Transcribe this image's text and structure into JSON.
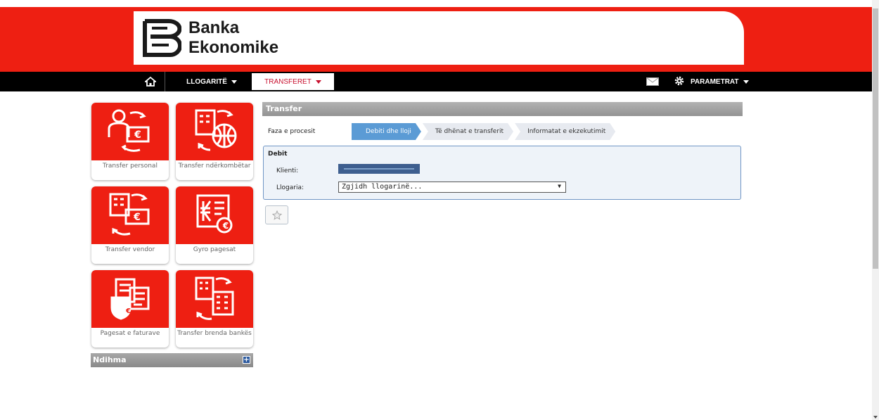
{
  "brand": {
    "line1": "Banka",
    "line2": "Ekonomike",
    "accent_color": "#ee1f12"
  },
  "nav": {
    "home_icon": "home-icon",
    "items": [
      {
        "label": "LLOGARITË"
      },
      {
        "label": "TRANSFERET"
      }
    ],
    "mail_icon": "mail-icon",
    "settings_icon": "gear-icon",
    "settings_label": "PARAMETRAT"
  },
  "tiles": [
    {
      "label": "Transfer personal",
      "icon": "personal-transfer-icon"
    },
    {
      "label": "Transfer ndërkombëtar",
      "icon": "international-transfer-icon"
    },
    {
      "label": "Transfer vendor",
      "icon": "domestic-transfer-icon"
    },
    {
      "label": "Gyro pagesat",
      "icon": "giro-payment-icon"
    },
    {
      "label": "Pagesat e faturave",
      "icon": "bill-payment-icon"
    },
    {
      "label": "Transfer brenda bankës",
      "icon": "intrabank-transfer-icon"
    }
  ],
  "help": {
    "label": "Ndihma"
  },
  "panel": {
    "title": "Transfer",
    "process_label": "Faza e procesit",
    "steps": [
      {
        "label": "Debiti dhe lloji",
        "active": true
      },
      {
        "label": "Të dhënat e transferit",
        "active": false
      },
      {
        "label": "Informatat e ekzekutimit",
        "active": false
      }
    ],
    "debit": {
      "title": "Debit",
      "client_label": "Klienti:",
      "account_label": "Llogaria:",
      "account_value": "Zgjidh llogarinë..."
    }
  }
}
